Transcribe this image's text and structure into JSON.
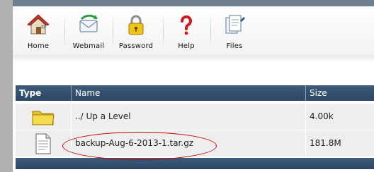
{
  "toolbar": {
    "items": [
      {
        "label": "Home",
        "icon": "home-icon"
      },
      {
        "label": "Webmail",
        "icon": "webmail-icon"
      },
      {
        "label": "Password",
        "icon": "lock-icon"
      },
      {
        "label": "Help",
        "icon": "help-icon"
      },
      {
        "label": "Files",
        "icon": "files-icon"
      }
    ]
  },
  "table": {
    "headers": [
      "Type",
      "Name",
      "Size"
    ],
    "rows": [
      {
        "type_icon": "folder-icon",
        "name": "../ Up a Level",
        "size": "4.00k"
      },
      {
        "type_icon": "document-icon",
        "name": "backup-Aug-6-2013-1.tar.gz",
        "size": "181.8M"
      }
    ]
  },
  "colors": {
    "header_bg": "#34506f",
    "row_bg": "#eeeeee",
    "highlight": "#c40000"
  }
}
